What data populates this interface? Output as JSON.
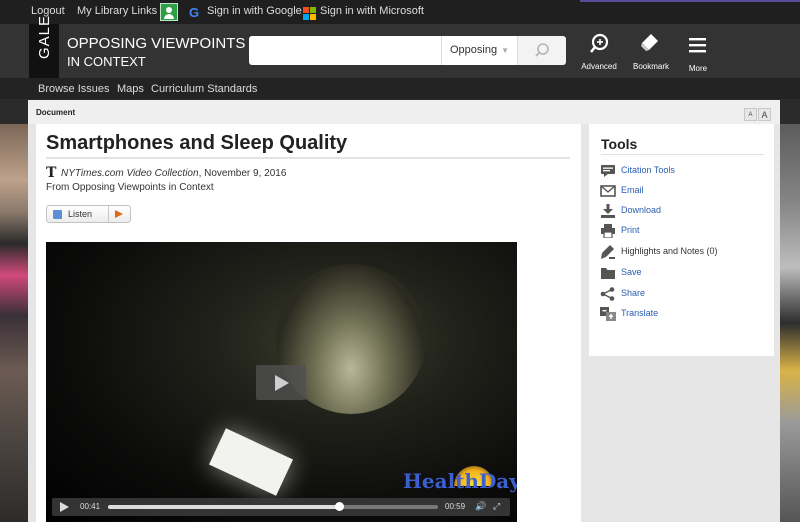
{
  "topbar": {
    "logout": "Logout",
    "library_links": "My Library Links",
    "google_g": "G",
    "signin_google": "Sign in with Google",
    "signin_microsoft": "Sign in with Microsoft"
  },
  "header": {
    "logo": "GALE",
    "brand_line1": "OPPOSING VIEWPOINTS",
    "brand_line2": "IN CONTEXT",
    "search_value": "",
    "search_scope": "Opposing",
    "advanced": "Advanced",
    "bookmark": "Bookmark",
    "more": "More"
  },
  "nav": {
    "browse_issues": "Browse Issues",
    "maps": "Maps",
    "curriculum_standards": "Curriculum Standards"
  },
  "docbar": {
    "label": "Document",
    "font_smaller": "A",
    "font_larger": "A"
  },
  "article": {
    "title": "Smartphones and Sleep Quality",
    "nyt_logo": "T",
    "source_name": "NYTimes.com Video Collection",
    "source_date": ", November 9, 2016",
    "from": "From Opposing Viewpoints in Context",
    "listen": "Listen"
  },
  "video": {
    "current_time": "00:41",
    "duration": "00:59",
    "progress_fraction": 0.7,
    "watermark": "HealthDay"
  },
  "tools": {
    "title": "Tools",
    "items": [
      {
        "label": "Citation Tools",
        "icon": "citation-icon",
        "link": true
      },
      {
        "label": "Email",
        "icon": "email-icon",
        "link": true
      },
      {
        "label": "Download",
        "icon": "download-icon",
        "link": true
      },
      {
        "label": "Print",
        "icon": "print-icon",
        "link": true
      },
      {
        "label": "Highlights and Notes (0)",
        "icon": "highlight-icon",
        "link": false
      },
      {
        "label": "Save",
        "icon": "folder-icon",
        "link": true
      },
      {
        "label": "Share",
        "icon": "share-icon",
        "link": true
      },
      {
        "label": "Translate",
        "icon": "translate-icon",
        "link": true
      }
    ]
  },
  "colors": {
    "header_bg": "#333333",
    "link_blue": "#2a5db0",
    "listen_orange": "#e06a17"
  }
}
